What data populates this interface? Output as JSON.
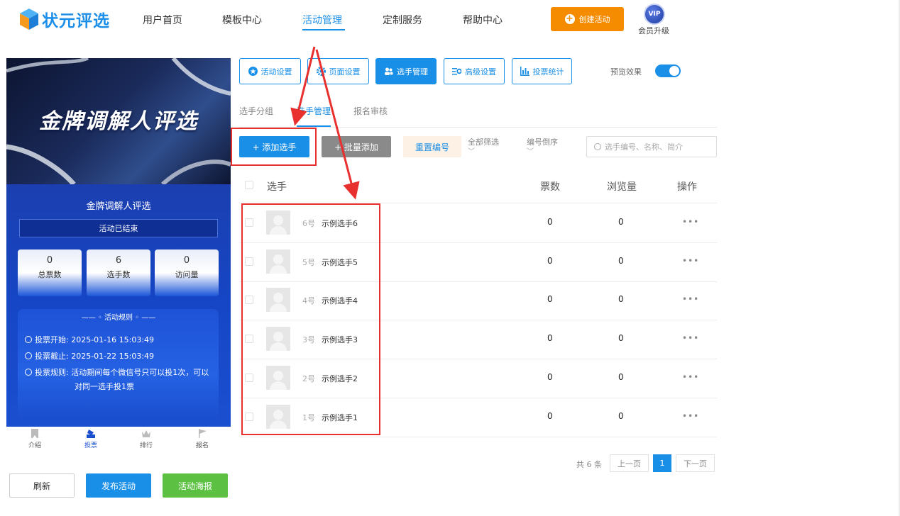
{
  "brand": {
    "name": "状元评选"
  },
  "nav": {
    "items": [
      {
        "label": "用户首页"
      },
      {
        "label": "模板中心"
      },
      {
        "label": "活动管理"
      },
      {
        "label": "定制服务"
      },
      {
        "label": "帮助中心"
      }
    ],
    "active_index": 2,
    "create_label": "创建活动",
    "vip_badge": "VIP",
    "vip_label": "会员升级"
  },
  "preview": {
    "banner_title": "金牌调解人评选",
    "activity_name": "金牌调解人评选",
    "status": "活动已结束",
    "stats": [
      {
        "value": "0",
        "label": "总票数"
      },
      {
        "value": "6",
        "label": "选手数"
      },
      {
        "value": "0",
        "label": "访问量"
      }
    ],
    "rules_title": "—— ◦ 活动规则 ◦ ——",
    "rules": {
      "start": "投票开始: 2025-01-16 15:03:49",
      "end": "投票截止: 2025-01-22 15:03:49",
      "rule_line1": "投票规则: 活动期间每个微信号只可以投1次，可以",
      "rule_line2": "对同一选手投1票"
    },
    "tabbar": [
      {
        "label": "介绍",
        "icon": "bookmark-icon"
      },
      {
        "label": "投票",
        "icon": "vote-icon"
      },
      {
        "label": "排行",
        "icon": "crown-icon"
      },
      {
        "label": "报名",
        "icon": "flag-icon"
      }
    ],
    "tabbar_active": 1
  },
  "actions": {
    "refresh": "刷新",
    "publish": "发布活动",
    "poster": "活动海报"
  },
  "settings_tabs": [
    {
      "label": "活动设置",
      "icon": "star-icon"
    },
    {
      "label": "页面设置",
      "icon": "gear-icon"
    },
    {
      "label": "选手管理",
      "icon": "users-icon"
    },
    {
      "label": "高级设置",
      "icon": "sliders-icon"
    },
    {
      "label": "投票统计",
      "icon": "bar-chart-icon"
    }
  ],
  "settings_active": 2,
  "preview_toggle": {
    "label": "预览效果",
    "on": true
  },
  "sub_tabs": [
    {
      "label": "选手分组"
    },
    {
      "label": "选手管理"
    },
    {
      "label": "报名审核"
    }
  ],
  "sub_active": 1,
  "toolbar": {
    "add": "+ 添加选手",
    "batch": "+ 批量添加",
    "renumber": "重置编号",
    "filter_all": "全部筛选",
    "sort": "编号倒序",
    "search_placeholder": "选手编号、名称、简介"
  },
  "table": {
    "headers": {
      "candidate": "选手",
      "votes": "票数",
      "views": "浏览量",
      "ops": "操作"
    },
    "rows": [
      {
        "num": "6号",
        "name": "示例选手6",
        "votes": "0",
        "views": "0",
        "more": "•••"
      },
      {
        "num": "5号",
        "name": "示例选手5",
        "votes": "0",
        "views": "0",
        "more": "•••"
      },
      {
        "num": "4号",
        "name": "示例选手4",
        "votes": "0",
        "views": "0",
        "more": "•••"
      },
      {
        "num": "3号",
        "name": "示例选手3",
        "votes": "0",
        "views": "0",
        "more": "•••"
      },
      {
        "num": "2号",
        "name": "示例选手2",
        "votes": "0",
        "views": "0",
        "more": "•••"
      },
      {
        "num": "1号",
        "name": "示例选手1",
        "votes": "0",
        "views": "0",
        "more": "•••"
      }
    ]
  },
  "pagination": {
    "total": "共 6 条",
    "prev": "上一页",
    "current": "1",
    "next": "下一页"
  },
  "colors": {
    "primary": "#1a8fe8",
    "orange": "#f58c00",
    "green": "#5cc142",
    "annotation": "#e8312e"
  }
}
